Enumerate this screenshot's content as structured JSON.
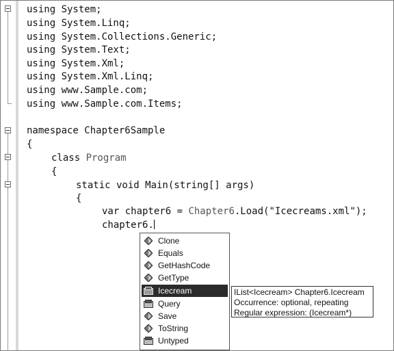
{
  "editor": {
    "using_lines": [
      "using System;",
      "using System.Linq;",
      "using System.Collections.Generic;",
      "using System.Text;",
      "using System.Xml;",
      "using System.Xml.Linq;",
      "using www.Sample.com;",
      "using www.Sample.com.Items;"
    ],
    "namespace_line": "namespace Chapter6Sample",
    "open_brace_1": "{",
    "class_keyword": "class ",
    "class_name": "Program",
    "open_brace_2": "{",
    "main_signature": "static void Main(string[] args)",
    "open_brace_3": "{",
    "load_prefix": "var chapter6 = ",
    "load_type": "Chapter6",
    "load_suffix": ".Load(\"Icecreams.xml\");",
    "typing_line": "chapter6."
  },
  "completion": {
    "items": [
      {
        "label": "Clone",
        "icon": "method-icon"
      },
      {
        "label": "Equals",
        "icon": "method-icon"
      },
      {
        "label": "GetHashCode",
        "icon": "method-icon"
      },
      {
        "label": "GetType",
        "icon": "method-icon"
      },
      {
        "label": "Icecream",
        "icon": "property-icon",
        "selected": true
      },
      {
        "label": "Query",
        "icon": "property-icon"
      },
      {
        "label": "Save",
        "icon": "method-icon"
      },
      {
        "label": "ToString",
        "icon": "method-icon"
      },
      {
        "label": "Untyped",
        "icon": "property-icon"
      }
    ]
  },
  "tooltip": {
    "line1": "IList<Icecream> Chapter6.Icecream",
    "line2": "Occurrence: optional, repeating",
    "line3": "Regular expression: (Icecream*)"
  }
}
